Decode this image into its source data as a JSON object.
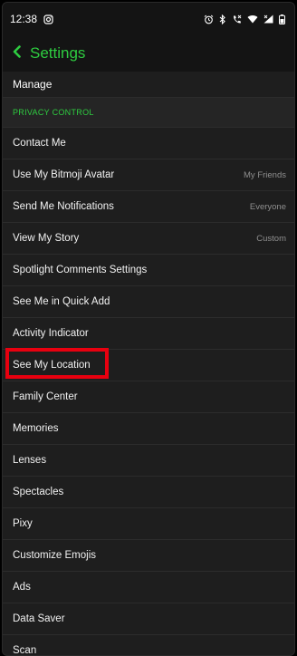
{
  "status": {
    "time": "12:38"
  },
  "header": {
    "title": "Settings"
  },
  "top_item": "Manage",
  "section": {
    "title": "PRIVACY CONTROL"
  },
  "rows": [
    {
      "label": "Contact Me",
      "value": ""
    },
    {
      "label": "Use My Bitmoji Avatar",
      "value": "My Friends"
    },
    {
      "label": "Send Me Notifications",
      "value": "Everyone"
    },
    {
      "label": "View My Story",
      "value": "Custom"
    },
    {
      "label": "Spotlight Comments Settings",
      "value": ""
    },
    {
      "label": "See Me in Quick Add",
      "value": ""
    },
    {
      "label": "Activity Indicator",
      "value": ""
    },
    {
      "label": "See My Location",
      "value": "",
      "highlighted": true
    },
    {
      "label": "Family Center",
      "value": ""
    },
    {
      "label": "Memories",
      "value": ""
    },
    {
      "label": "Lenses",
      "value": ""
    },
    {
      "label": "Spectacles",
      "value": ""
    },
    {
      "label": "Pixy",
      "value": ""
    },
    {
      "label": "Customize Emojis",
      "value": ""
    },
    {
      "label": "Ads",
      "value": ""
    },
    {
      "label": "Data Saver",
      "value": ""
    },
    {
      "label": "Scan",
      "value": ""
    }
  ],
  "colors": {
    "accent": "#2ecc40",
    "highlight": "#e8000f",
    "background": "#1e1e1e"
  },
  "icons": {
    "status_left": [
      "instagram-icon"
    ],
    "status_right": [
      "alarm-icon",
      "bluetooth-icon",
      "call-icon",
      "wifi-icon",
      "signal-icon",
      "battery-icon"
    ],
    "header": "back-chevron-icon"
  }
}
